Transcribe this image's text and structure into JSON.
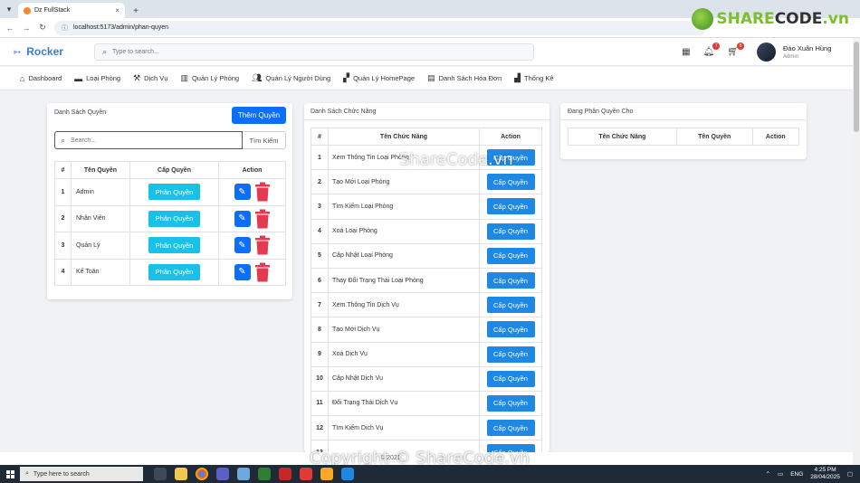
{
  "browser": {
    "tab_title": "Dz FullStack",
    "url": "localhost:5173/admin/phan-quyen"
  },
  "watermark": {
    "logo_prefix": "SHARE",
    "logo_suffix": "CODE",
    "logo_tld": ".vn",
    "center_text": "ShareCode.vn",
    "bottom_text": "Copyright © ShareCode.vn"
  },
  "header": {
    "brand": "Rocker",
    "search_placeholder": "Type to search...",
    "notif_count": "7",
    "message_count": "8",
    "user_name": "Đào Xuân Hùng",
    "user_role": "Admin"
  },
  "menu": [
    {
      "label": "Dashboard",
      "icon": "home-icon"
    },
    {
      "label": "Loại Phòng",
      "icon": "bed-icon"
    },
    {
      "label": "Dịch Vụ",
      "icon": "service-icon"
    },
    {
      "label": "Quản Lý Phòng",
      "icon": "building-icon"
    },
    {
      "label": "Quản Lý Người Dùng",
      "icon": "users-icon"
    },
    {
      "label": "Quản Lý HomePage",
      "icon": "homepage-icon"
    },
    {
      "label": "Danh Sách Hóa Đơn",
      "icon": "invoice-icon"
    },
    {
      "label": "Thống Kê",
      "icon": "chart-icon"
    }
  ],
  "roles_card": {
    "title": "Danh Sách Quyền",
    "add_button": "Thêm Quyền",
    "search_placeholder": "Search...",
    "search_button": "Tìm Kiếm",
    "headers": [
      "#",
      "Tên Quyền",
      "Cấp Quyền",
      "Action"
    ],
    "assign_label": "Phân Quyền",
    "rows": [
      {
        "num": "1",
        "name": "Admin"
      },
      {
        "num": "2",
        "name": "Nhân Viên"
      },
      {
        "num": "3",
        "name": "Quản Lý"
      },
      {
        "num": "4",
        "name": "Kế Toán"
      }
    ]
  },
  "functions_card": {
    "title": "Danh Sách Chức Năng",
    "headers": [
      "#",
      "Tên Chức Năng",
      "Action"
    ],
    "grant_label": "Cấp Quyền",
    "rows": [
      {
        "num": "1",
        "name": "Xem Thông Tin Loại Phòng"
      },
      {
        "num": "2",
        "name": "Tạo Mới Loại Phòng"
      },
      {
        "num": "3",
        "name": "Tìm Kiếm Loại Phòng"
      },
      {
        "num": "4",
        "name": "Xoá Loại Phòng"
      },
      {
        "num": "5",
        "name": "Cập Nhật Loại Phòng"
      },
      {
        "num": "6",
        "name": "Thay Đổi Trạng Thái Loại Phòng"
      },
      {
        "num": "7",
        "name": "Xem Thông Tin Dịch Vụ"
      },
      {
        "num": "8",
        "name": "Tạo Mới Dịch Vụ"
      },
      {
        "num": "9",
        "name": "Xoá Dịch Vụ"
      },
      {
        "num": "10",
        "name": "Cập Nhật Dịch Vụ"
      },
      {
        "num": "11",
        "name": "Đổi Trạng Thái Dịch Vụ"
      },
      {
        "num": "12",
        "name": "Tìm Kiếm Dịch Vụ"
      },
      {
        "num": "13",
        "name": ""
      }
    ]
  },
  "assigned_card": {
    "title": "Đang Phân Quyền Cho",
    "headers": [
      "Tên Chức Năng",
      "Tên Quyền",
      "Action"
    ]
  },
  "footer": {
    "text": "© 2021"
  },
  "taskbar": {
    "search_placeholder": "Type here to search",
    "lang": "ENG",
    "time": "4:25 PM",
    "date": "28/04/2025"
  }
}
